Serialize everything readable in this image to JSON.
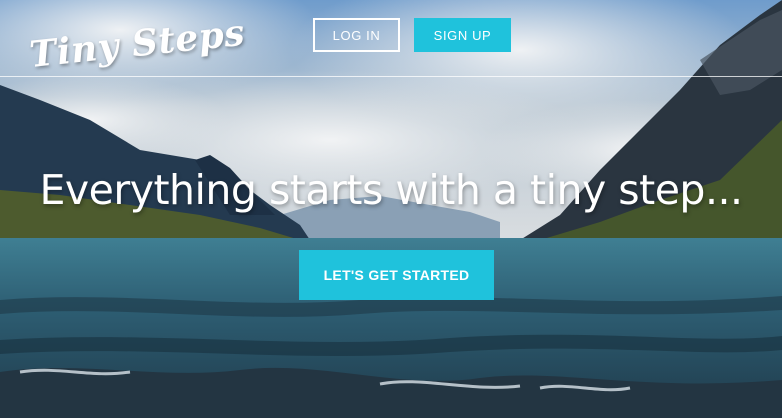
{
  "brand": {
    "logo_text": "Tiny Steps"
  },
  "nav": {
    "login_label": "LOG IN",
    "signup_label": "SIGN UP"
  },
  "hero": {
    "tagline": "Everything starts with a tiny step...",
    "cta_label": "LET'S GET STARTED",
    "background_image": "mountain-lake-landscape"
  },
  "colors": {
    "accent": "#1fc2dc",
    "text": "#ffffff",
    "sky": "#5b8fc2",
    "water": "#2f6177"
  }
}
